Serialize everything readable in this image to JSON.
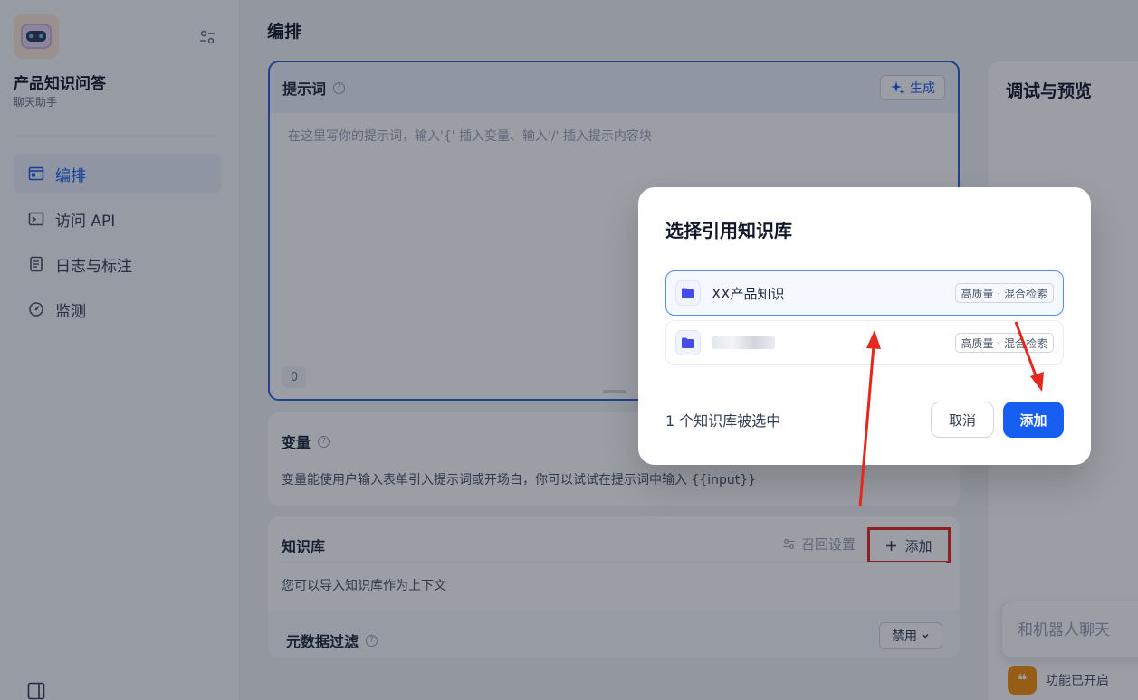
{
  "sidebar": {
    "app_name": "产品知识问答",
    "app_type": "聊天助手",
    "nav": [
      {
        "label": "编排",
        "icon": "layout-icon",
        "active": true
      },
      {
        "label": "访问 API",
        "icon": "terminal-icon",
        "active": false
      },
      {
        "label": "日志与标注",
        "icon": "file-list-icon",
        "active": false
      },
      {
        "label": "监测",
        "icon": "gauge-icon",
        "active": false
      }
    ]
  },
  "main": {
    "page_title": "编排",
    "prompt": {
      "label": "提示词",
      "generate_label": "生成",
      "placeholder": "在这里写你的提示词，输入'{' 插入变量、输入'/' 插入提示内容块",
      "char_count": "0"
    },
    "variables": {
      "label": "变量",
      "description": "变量能使用户输入表单引入提示词或开场白，你可以试试在提示词中输入 {{input}}"
    },
    "knowledge": {
      "label": "知识库",
      "recall_settings": "召回设置",
      "add_label": "添加",
      "description": "您可以导入知识库作为上下文",
      "metadata_filter_label": "元数据过滤",
      "metadata_filter_value": "禁用"
    }
  },
  "preview": {
    "title": "调试与预览",
    "chat_placeholder": "和机器人聊天",
    "feature_status": "功能已开启"
  },
  "modal": {
    "title": "选择引用知识库",
    "items": [
      {
        "name": "XX产品知识",
        "tag": "高质量 · 混合检索",
        "selected": true
      },
      {
        "name": "",
        "tag": "高质量 · 混合检索",
        "selected": false
      }
    ],
    "selected_count": "1 个知识库被选中",
    "cancel_label": "取消",
    "confirm_label": "添加"
  },
  "colors": {
    "accent": "#155eef",
    "annotation_red": "#e5281f"
  }
}
